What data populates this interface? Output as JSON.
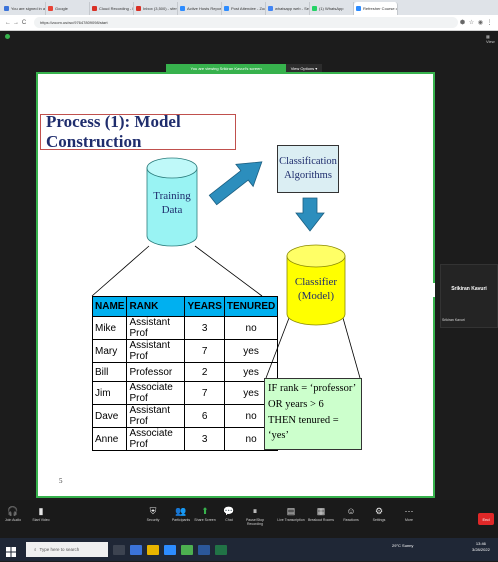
{
  "browser": {
    "tabs": [
      {
        "label": "You are signed in as",
        "color": "#3b73d9"
      },
      {
        "label": "Google",
        "color": "#e84335"
      },
      {
        "label": "Cloud Recording - Fri",
        "color": "#d93025"
      },
      {
        "label": "Inbox (3,500) - sferri",
        "color": "#d93025"
      },
      {
        "label": "Active Hosts Report",
        "color": "#2d8cff"
      },
      {
        "label": "Post Attendee - Zoom",
        "color": "#2d8cff"
      },
      {
        "label": "whatsapp web - Sear",
        "color": "#4285f4"
      },
      {
        "label": "(1) WhatsApp",
        "color": "#25d366"
      },
      {
        "label": "Refresher Course on",
        "color": "#2d8cff"
      }
    ],
    "url": "https://zoom.us/wc/97647809098/start",
    "nav": {
      "back": "←",
      "forward": "→",
      "reload": "C"
    }
  },
  "zoom": {
    "viewing_banner": "You are viewing Srikiran Kavuri's screen",
    "view_options": "View Options ▾",
    "participant_name": "Srikiran Kavuri",
    "participant_label": "Srikiran Kavuri",
    "toolbar": [
      {
        "label": "Join Audio",
        "icon": "headphones-icon",
        "glyph": "🎧"
      },
      {
        "label": "Start Video",
        "icon": "video-off-icon",
        "glyph": "▮"
      },
      {
        "label": "Security",
        "icon": "shield-icon",
        "glyph": "⛨"
      },
      {
        "label": "Participants",
        "icon": "participants-icon",
        "glyph": "👥"
      },
      {
        "label": "Share Screen",
        "icon": "share-screen-icon",
        "glyph": "⬆"
      },
      {
        "label": "Chat",
        "icon": "chat-icon",
        "glyph": "💬"
      },
      {
        "label": "Pause/Stop Recording",
        "icon": "record-icon",
        "glyph": "⏸"
      },
      {
        "label": "Live Transcription",
        "icon": "cc-icon",
        "glyph": "▤"
      },
      {
        "label": "Breakout Rooms",
        "icon": "breakout-icon",
        "glyph": "▦"
      },
      {
        "label": "Reactions",
        "icon": "reaction-icon",
        "glyph": "☺"
      },
      {
        "label": "Settings",
        "icon": "settings-icon",
        "glyph": "⚙"
      },
      {
        "label": "More",
        "icon": "more-icon",
        "glyph": "⋯"
      }
    ],
    "end": "End"
  },
  "slide": {
    "title": "Process (1): Model Construction",
    "training_data": [
      "Training",
      "Data"
    ],
    "algorithms": [
      "Classification",
      "Algorithms"
    ],
    "classifier": [
      "Classifier",
      "(Model)"
    ],
    "table": {
      "headers": [
        "NAME",
        "RANK",
        "YEARS",
        "TENURED"
      ],
      "rows": [
        [
          "Mike",
          "Assistant Prof",
          "3",
          "no"
        ],
        [
          "Mary",
          "Assistant Prof",
          "7",
          "yes"
        ],
        [
          "Bill",
          "Professor",
          "2",
          "yes"
        ],
        [
          "Jim",
          "Associate Prof",
          "7",
          "yes"
        ],
        [
          "Dave",
          "Assistant Prof",
          "6",
          "no"
        ],
        [
          "Anne",
          "Associate Prof",
          "3",
          "no"
        ]
      ]
    },
    "rule": [
      "IF rank = ‘professor’",
      "OR years > 6",
      "THEN tenured = ‘yes’"
    ],
    "page_number": "5"
  },
  "taskbar": {
    "search_placeholder": "Type here to search",
    "weather": "29°C Sunny",
    "time": "13:46",
    "date": "3/28/2022"
  }
}
